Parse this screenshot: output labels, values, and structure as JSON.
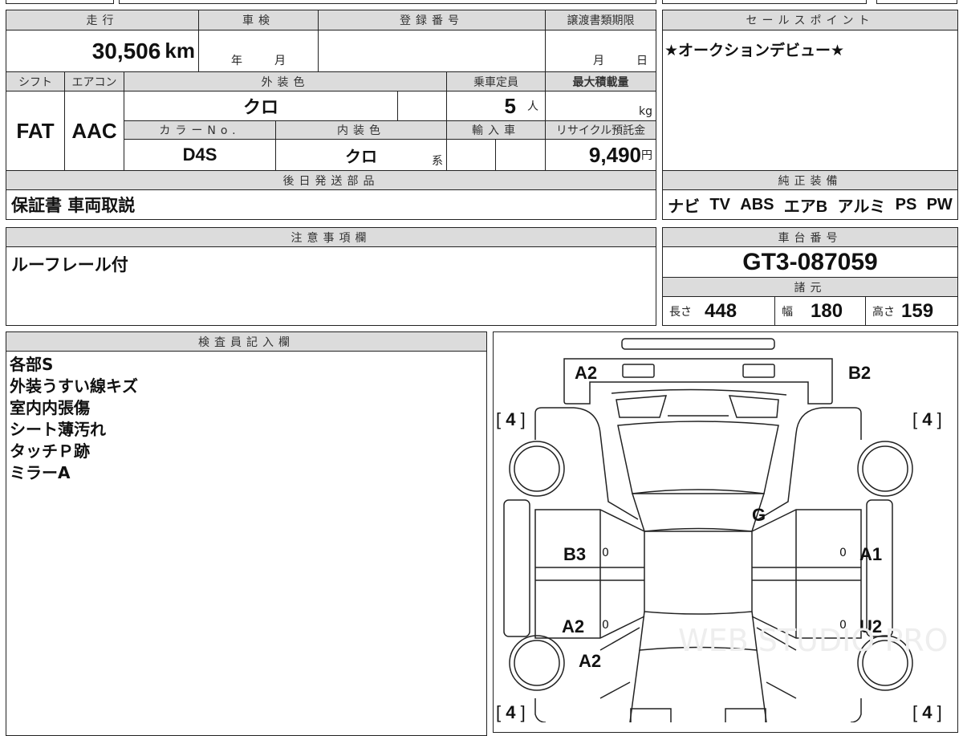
{
  "mileage": {
    "label": "走行",
    "value": "30,506",
    "unit": "km"
  },
  "inspection": {
    "label": "車検",
    "year": "年",
    "month": "月"
  },
  "registration": {
    "label": "登録番号"
  },
  "transfer": {
    "label": "譲渡書類期限",
    "month": "月",
    "day": "日"
  },
  "shift": {
    "label": "シフト",
    "value": "FAT"
  },
  "aircon": {
    "label": "エアコン",
    "value": "AAC"
  },
  "exterior_color": {
    "label": "外装色",
    "value": "クロ"
  },
  "capacity": {
    "label": "乗車定員",
    "value": "5",
    "unit": "人"
  },
  "max_load": {
    "label": "最大積載量",
    "unit": "kg"
  },
  "color_no": {
    "label": "カラーNo.",
    "value": "D4S"
  },
  "interior_color": {
    "label": "内装色",
    "value": "クロ",
    "suffix": "系"
  },
  "import": {
    "label": "輸入車"
  },
  "recycle": {
    "label": "リサイクル預託金",
    "value": "9,490",
    "unit": "円"
  },
  "later_parts": {
    "label": "後日発送部品",
    "value": "保証書 車両取説"
  },
  "sales_point": {
    "label": "セールスポイント",
    "value": "★オークションデビュー★"
  },
  "equipment": {
    "label": "純正装備",
    "items": [
      "ナビ",
      "TV",
      "ABS",
      "エアB",
      "アルミ",
      "PS",
      "PW"
    ]
  },
  "notes": {
    "label": "注意事項欄",
    "value": "ルーフレール付"
  },
  "chassis": {
    "label": "車台番号",
    "value": "GT3-087059"
  },
  "specs": {
    "label": "諸元",
    "length_label": "長さ",
    "length": "448",
    "width_label": "幅",
    "width": "180",
    "height_label": "高さ",
    "height": "159"
  },
  "inspector": {
    "label": "検査員記入欄",
    "lines": [
      "各部S",
      "外装うすい線キズ",
      "室内内張傷",
      "シート薄汚れ",
      "タッチＰ跡",
      "ミラーA"
    ]
  },
  "diagram": {
    "marks": [
      "A2",
      "B2",
      "G",
      "B3",
      "A1",
      "A2",
      "U2",
      "A2"
    ],
    "tires": [
      "4",
      "4",
      "4",
      "4"
    ],
    "zero": "0",
    "watermark": "WEB STUDIO PRO"
  }
}
